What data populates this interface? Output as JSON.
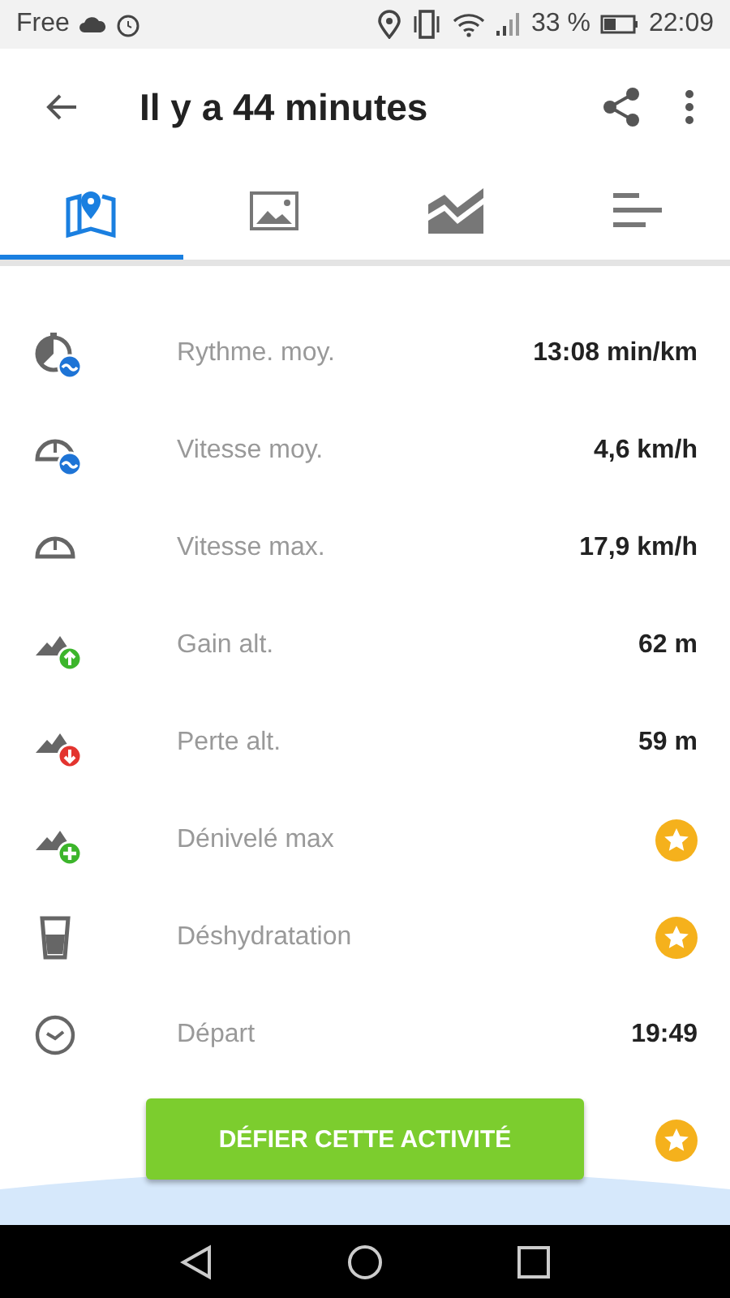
{
  "status_bar": {
    "carrier": "Free",
    "battery": "33 %",
    "time": "22:09"
  },
  "app_bar": {
    "title": "Il y a 44 minutes"
  },
  "tabs": [
    {
      "selected": true
    },
    {
      "selected": false
    },
    {
      "selected": false
    },
    {
      "selected": false
    }
  ],
  "stats": [
    {
      "label": "Rythme. moy.",
      "kind": "value",
      "value": "13:08 min/km"
    },
    {
      "label": "Vitesse moy.",
      "kind": "value",
      "value": "4,6 km/h"
    },
    {
      "label": "Vitesse max.",
      "kind": "value",
      "value": "17,9 km/h"
    },
    {
      "label": "Gain alt.",
      "kind": "value",
      "value": "62 m"
    },
    {
      "label": "Perte alt.",
      "kind": "value",
      "value": "59 m"
    },
    {
      "label": "Dénivelé max",
      "kind": "premium"
    },
    {
      "label": "Déshydratation",
      "kind": "premium"
    },
    {
      "label": "Départ",
      "kind": "value",
      "value": "19:49"
    }
  ],
  "challenge_button": {
    "label": "DÉFIER CETTE ACTIVITÉ",
    "premium": true
  }
}
